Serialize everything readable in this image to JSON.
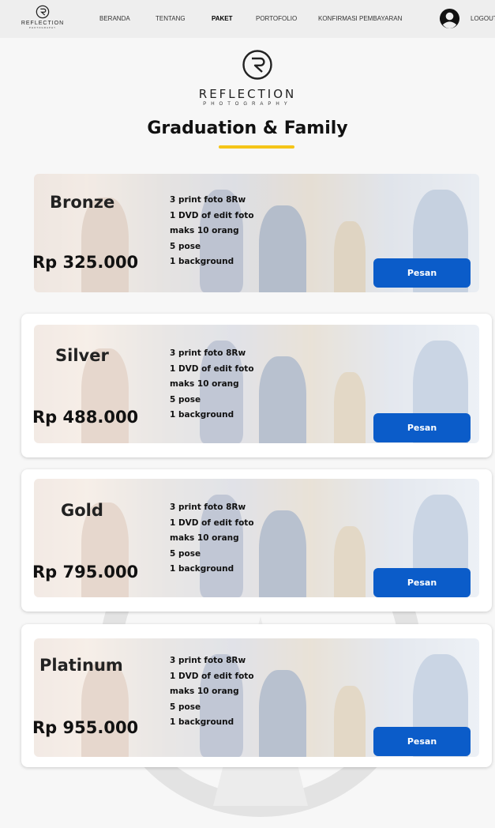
{
  "nav": {
    "brand": "REFLECTION",
    "brand_sub": "PHOTOGRAPHY",
    "items": [
      {
        "label": "BERANDA"
      },
      {
        "label": "TENTANG"
      },
      {
        "label": "PAKET",
        "active": true
      },
      {
        "label": "PORTOFOLIO"
      },
      {
        "label": "KONFIRMASI PEMBAYARAN"
      }
    ],
    "logout": "LOGOUT"
  },
  "header": {
    "brand": "REFLECTION",
    "brand_sub": "PHOTOGRAPHY",
    "title": "Graduation & Family",
    "accent_color": "#f5c518"
  },
  "packages": [
    {
      "name": "Bronze",
      "price": "Rp 325.000",
      "features": [
        "3 print foto 8Rw",
        "1 DVD of edit foto",
        "maks 10 orang",
        "5 pose",
        "1 background"
      ],
      "button": "Pesan"
    },
    {
      "name": "Silver",
      "price": "Rp 488.000",
      "features": [
        "3 print foto 8Rw",
        "1 DVD of edit foto",
        "maks 10 orang",
        "5 pose",
        "1 background"
      ],
      "button": "Pesan"
    },
    {
      "name": "Gold",
      "price": "Rp 795.000",
      "features": [
        "3 print foto 8Rw",
        "1 DVD of edit foto",
        "maks 10 orang",
        "5 pose",
        "1 background"
      ],
      "button": "Pesan"
    },
    {
      "name": "Platinum",
      "price": "Rp 955.000",
      "features": [
        "3 print foto 8Rw",
        "1 DVD of edit foto",
        "maks 10 orang",
        "5 pose",
        "1 background"
      ],
      "button": "Pesan"
    }
  ],
  "colors": {
    "button": "#0b5cc9",
    "navbar": "#eeeeee"
  }
}
